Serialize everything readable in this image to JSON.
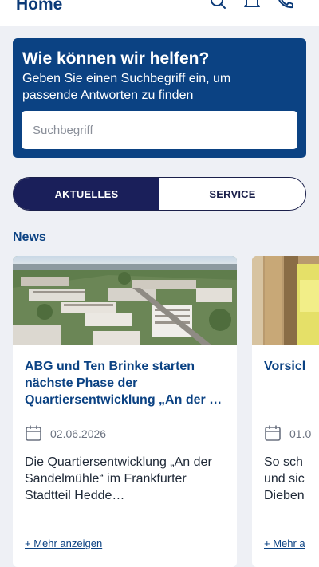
{
  "header": {
    "title": "Home",
    "icons": [
      "search-icon",
      "bell-icon",
      "phone-icon"
    ]
  },
  "search": {
    "heading": "Wie können wir helfen?",
    "subtitle": "Geben Sie einen Suchbegriff ein, um passende Antworten zu finden",
    "placeholder": "Suchbegriff",
    "value": ""
  },
  "tabs": [
    {
      "label": "AKTUELLES",
      "active": true
    },
    {
      "label": "SERVICE",
      "active": false
    }
  ],
  "news": {
    "heading": "News",
    "cards": [
      {
        "title": "ABG und Ten Brinke starten nächste Phase der Quartiersentwicklung „An der …",
        "date": "02.06.2026",
        "text": "Die Quartiersentwicklung „An der Sandelmühle“ im Frankfurter Stadtteil Hedde…",
        "more": "+ Mehr anzeigen"
      },
      {
        "title": "Vorsicl",
        "date": "01.0",
        "text": "So sch und sic Dieben",
        "more": "+ Mehr a"
      }
    ]
  },
  "colors": {
    "brand": "#0b4283",
    "tab_active": "#1a1f5a",
    "background": "#eef0f5"
  }
}
